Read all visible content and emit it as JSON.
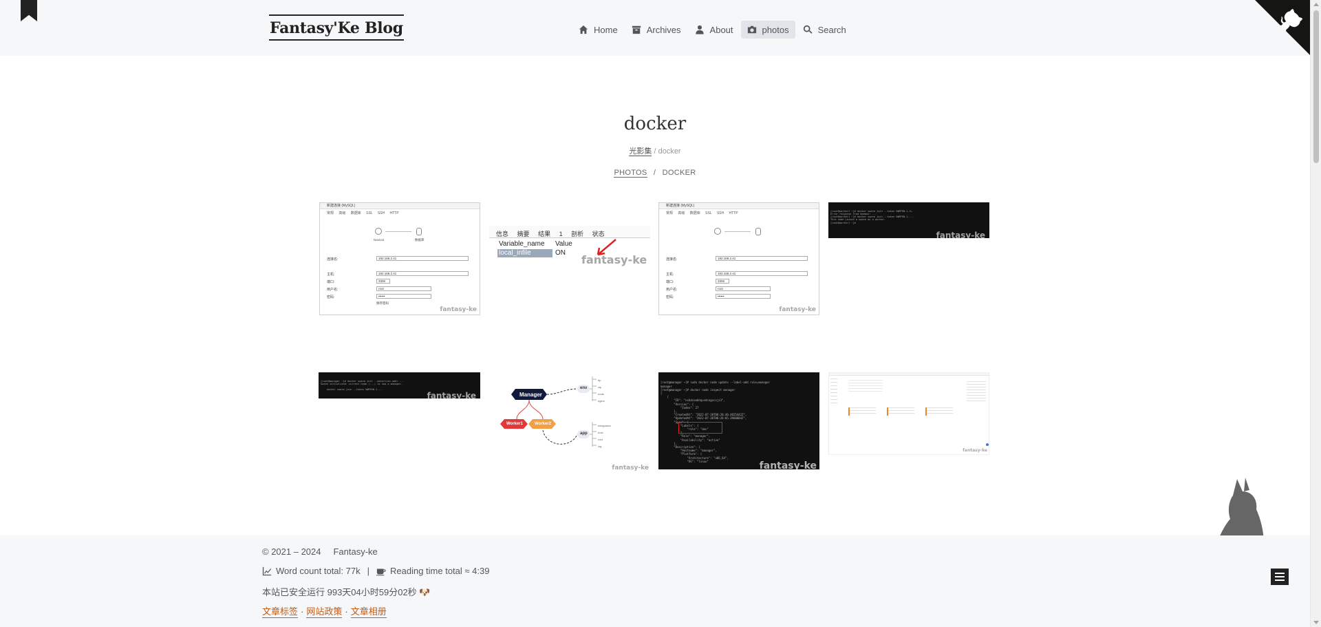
{
  "site": {
    "title": "Fantasy'Ke Blog"
  },
  "nav": [
    {
      "label": "Home",
      "icon": "home-icon"
    },
    {
      "label": "Archives",
      "icon": "archive-icon"
    },
    {
      "label": "About",
      "icon": "user-icon"
    },
    {
      "label": "photos",
      "icon": "camera-icon",
      "active": true
    },
    {
      "label": "Search",
      "icon": "search-icon"
    }
  ],
  "page": {
    "title": "docker",
    "breadcrumb_cn": {
      "parent": "光影集",
      "separator": "/",
      "current": "docker"
    },
    "breadcrumb_en": {
      "parent": "PHOTOS",
      "separator": "/",
      "current": "DOCKER"
    }
  },
  "gallery": {
    "watermark": "fantasy-ke",
    "dialog": {
      "title": "新建连接 (MySQL)",
      "tabs": "常规 高级 数据库 SSL SSH HTTP",
      "icons": [
        "Navicat",
        "数据库"
      ],
      "fields": [
        {
          "label": "连接名:",
          "value": "192.168.2.41"
        },
        {
          "label": "主机:",
          "value": "192.168.2.41"
        },
        {
          "label": "端口:",
          "value": "3306"
        },
        {
          "label": "用户名:",
          "value": "root"
        },
        {
          "label": "密码:",
          "value": "••••••"
        }
      ],
      "save_password": "保存密码"
    },
    "mysql_table": {
      "tabs": [
        "信息",
        "摘要",
        "结果 1",
        "剖析",
        "状态"
      ],
      "headers": [
        "Variable_name",
        "Value"
      ],
      "row": [
        "local_infile",
        "ON"
      ]
    },
    "diagram": {
      "manager": "Manager",
      "workers": [
        "Worker1",
        "Worker2"
      ],
      "env": "env",
      "app": "app",
      "env_items": [
        "ftp",
        "zip",
        "node",
        "nginx"
      ],
      "app_items": [
        "Integration",
        "host",
        "root",
        "log"
      ]
    }
  },
  "footer": {
    "copyright": "© 2021 – 2024",
    "author": "Fantasy-ke",
    "word_count": "Word count total: 77k",
    "separator": "|",
    "reading_time": "Reading time total ≈ 4:39",
    "runtime": "本站已安全运行 993天04小时59分02秒 🐶",
    "links": [
      "文章标签",
      "网站政策",
      "文章相册"
    ],
    "link_sep": "·"
  },
  "colors": {
    "accent_link": "#c55a11",
    "header_bg": "#f5f7f9",
    "theme_button": "#14143a"
  }
}
